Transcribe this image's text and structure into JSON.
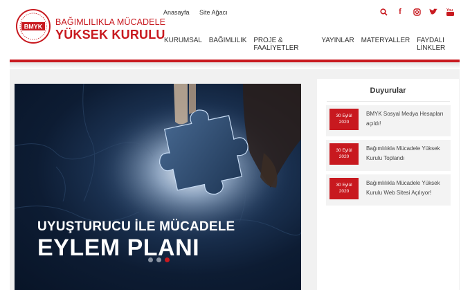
{
  "logo": {
    "text": "BMYK"
  },
  "brand": {
    "line1": "BAĞIMLILIKLA MÜCADELE",
    "line2": "YÜKSEK KURULU"
  },
  "toplinks": [
    "Anasayfa",
    "Site Ağacı"
  ],
  "social": [
    {
      "name": "search-icon",
      "glyph": "⚲"
    },
    {
      "name": "facebook-icon",
      "glyph": "f"
    },
    {
      "name": "instagram-icon",
      "glyph": "◘"
    },
    {
      "name": "twitter-icon",
      "glyph": "✈"
    },
    {
      "name": "youtube-icon",
      "glyph": "▶"
    }
  ],
  "nav": [
    "KURUMSAL",
    "BAĞIMLILIK",
    "PROJE & FAALİYETLER",
    "YAYINLAR",
    "MATERYALLER",
    "FAYDALI LİNKLER"
  ],
  "slider": {
    "title_line1": "UYUŞTURUCU İLE MÜCADELE",
    "title_line2": "EYLEM PLANI",
    "slide_count": 3,
    "active_slide": 3
  },
  "announcements": {
    "title": "Duyurular",
    "items": [
      {
        "date_day": "30 Eylül",
        "date_year": "2020",
        "text": "BMYK Sosyal Medya Hesapları açıldı!"
      },
      {
        "date_day": "30 Eylül",
        "date_year": "2020",
        "text": "Bağımlılıkla Mücadele Yüksek Kurulu Toplandı"
      },
      {
        "date_day": "30 Eylül",
        "date_year": "2020",
        "text": "Bağımlılıkla Mücadele Yüksek Kurulu Web Sitesi Açılıyor!"
      }
    ]
  },
  "colors": {
    "brand_red": "#c8191f",
    "slider_dark": "#0d1c33"
  }
}
